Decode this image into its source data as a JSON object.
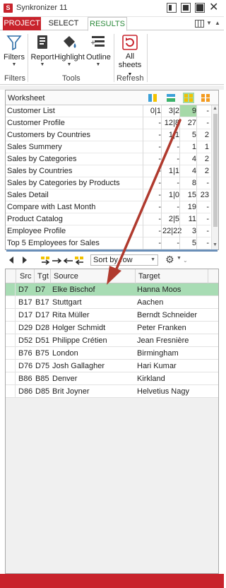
{
  "window": {
    "title": "Synkronizer 11",
    "app_icon": "S"
  },
  "tabs": [
    {
      "label": "PROJECT"
    },
    {
      "label": "SELECT"
    },
    {
      "label": "RESULTS"
    }
  ],
  "ribbon": {
    "filters_label": "Filters",
    "report_label": "Report",
    "highlight_label": "Highlight",
    "outline_label": "Outline",
    "all_sheets_label_1": "All",
    "all_sheets_label_2": "sheets",
    "group_filters": "Filters",
    "group_tools": "Tools",
    "group_refresh": "Refresh"
  },
  "worksheet": {
    "header": "Worksheet",
    "rows": [
      {
        "name": "Customer List",
        "c1": "0|1",
        "c2": "3|2",
        "c3": "9",
        "c4": "-"
      },
      {
        "name": "Customer Profile",
        "c1": "-",
        "c2": "12|8",
        "c3": "27",
        "c4": "-"
      },
      {
        "name": "Customers by Countries",
        "c1": "-",
        "c2": "1|1",
        "c3": "5",
        "c4": "2"
      },
      {
        "name": "Sales Summery",
        "c1": "-",
        "c2": "-",
        "c3": "1",
        "c4": "1"
      },
      {
        "name": "Sales by Categories",
        "c1": "-",
        "c2": "-",
        "c3": "4",
        "c4": "2"
      },
      {
        "name": "Sales by Countries",
        "c1": "-",
        "c2": "1|1",
        "c3": "4",
        "c4": "2"
      },
      {
        "name": "Sales by Categories by Products",
        "c1": "-",
        "c2": "-",
        "c3": "8",
        "c4": "-"
      },
      {
        "name": "Sales Detail",
        "c1": "-",
        "c2": "1|0",
        "c3": "15",
        "c4": "23"
      },
      {
        "name": "Compare with Last Month",
        "c1": "-",
        "c2": "-",
        "c3": "19",
        "c4": "-"
      },
      {
        "name": "Product Catalog",
        "c1": "-",
        "c2": "2|5",
        "c3": "11",
        "c4": "-"
      },
      {
        "name": "Employee Profile",
        "c1": "-",
        "c2": "22|22",
        "c3": "3",
        "c4": "-"
      },
      {
        "name": "Top 5 Employees for Sales",
        "c1": "-",
        "c2": "-",
        "c3": "5",
        "c4": "-"
      }
    ]
  },
  "toolbar2": {
    "sort_value": "Sort by row"
  },
  "grid": {
    "headers": {
      "src": "Src",
      "tgt": "Tgt",
      "source": "Source",
      "target": "Target"
    },
    "rows": [
      {
        "src": "D7",
        "tgt": "D7",
        "source": "Elke Bischof",
        "target": "Hanna Moos",
        "selected": true
      },
      {
        "src": "B17",
        "tgt": "B17",
        "source": "Stuttgart",
        "target": "Aachen"
      },
      {
        "src": "D17",
        "tgt": "D17",
        "source": "Rita Müller",
        "target": "Berndt Schneider"
      },
      {
        "src": "D29",
        "tgt": "D28",
        "source": "Holger Schmidt",
        "target": "Peter Franken"
      },
      {
        "src": "D52",
        "tgt": "D51",
        "source": "Philippe Crétien",
        "target": "Jean Fresnière"
      },
      {
        "src": "B76",
        "tgt": "B75",
        "source": "London",
        "target": "Birmingham"
      },
      {
        "src": "D76",
        "tgt": "D75",
        "source": "Josh Gallagher",
        "target": "Hari Kumar"
      },
      {
        "src": "B86",
        "tgt": "B85",
        "source": "Denver",
        "target": "Kirkland"
      },
      {
        "src": "D86",
        "tgt": "D85",
        "source": "Brit Joyner",
        "target": "Helvetius Nagy"
      }
    ]
  },
  "colors": {
    "brand_red": "#c8232c",
    "results_green": "#2c8a3b",
    "selection_green": "#a8dcb4",
    "annotation_arrow": "#b03a2e"
  }
}
